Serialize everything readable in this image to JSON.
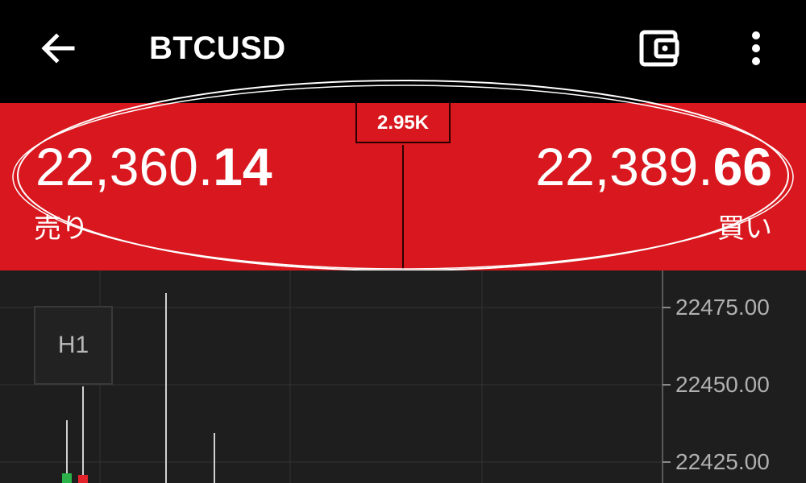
{
  "header": {
    "title": "BTCUSD",
    "back_icon": "arrow-left-icon",
    "wallet_icon": "wallet-icon",
    "more_icon": "more-vertical-icon"
  },
  "quote": {
    "spread": "2.95K",
    "sell": {
      "price_main": "22,360.",
      "price_big": "14",
      "label": "売り"
    },
    "buy": {
      "price_main": "22,389.",
      "price_big": "66",
      "label": "買い"
    }
  },
  "chart": {
    "timeframe": "H1",
    "price_labels": [
      "22475.00",
      "22450.00",
      "22425.00"
    ],
    "colors": {
      "up": "#2bb34a",
      "down": "#e2232a",
      "wick": "#d0d0d0"
    }
  },
  "colors": {
    "panel": "#d8181e",
    "topbar": "#000000",
    "chart_bg": "#1e1e1e"
  }
}
